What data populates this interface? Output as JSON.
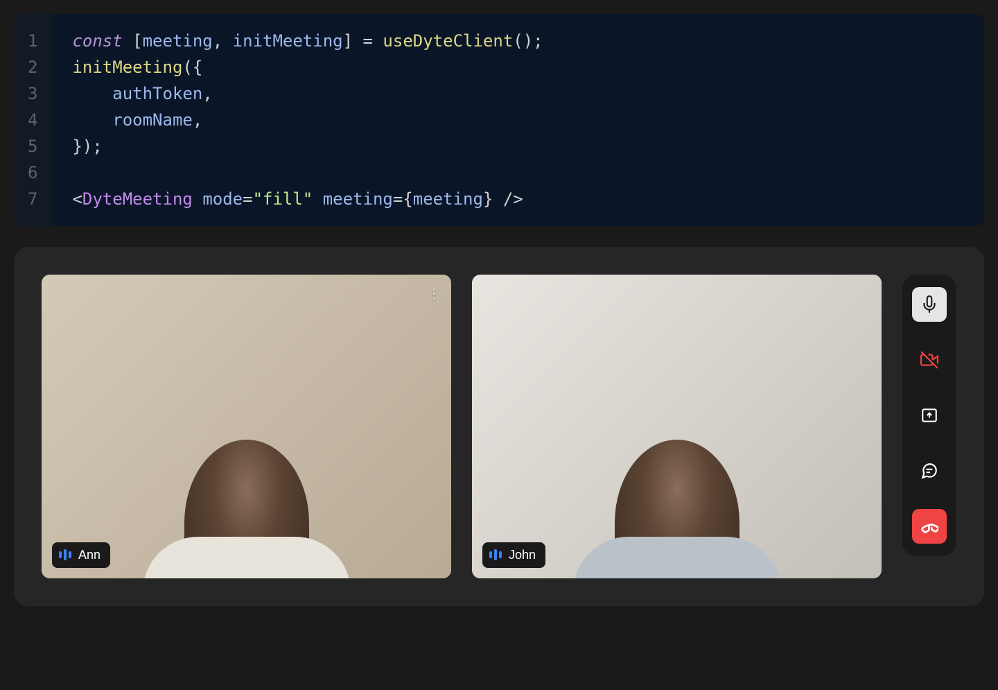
{
  "code": {
    "lines": [
      "1",
      "2",
      "3",
      "4",
      "5",
      "6",
      "7"
    ],
    "tokens": {
      "const": "const",
      "meeting": "meeting",
      "initMeeting": "initMeeting",
      "useDyteClient": "useDyteClient",
      "authToken": "authToken",
      "roomName": "roomName",
      "DyteMeeting": "DyteMeeting",
      "mode": "mode",
      "fill": "\"fill\"",
      "meetingAttr": "meeting"
    }
  },
  "videoCall": {
    "participants": [
      {
        "name": "Ann"
      },
      {
        "name": "John"
      }
    ],
    "controls": {
      "microphone": "microphone",
      "camera": "camera-off",
      "share": "share-screen",
      "chat": "chat",
      "hangup": "hangup"
    }
  }
}
